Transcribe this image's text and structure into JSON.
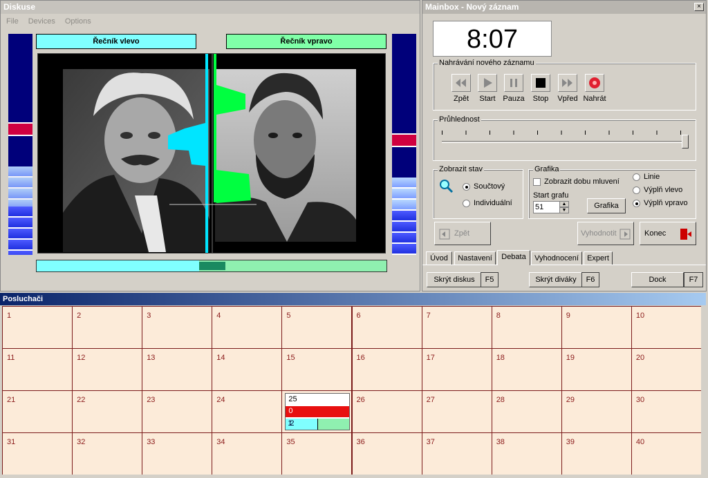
{
  "diskuse": {
    "title": "Diskuse",
    "menu": [
      "File",
      "Devices",
      "Options"
    ],
    "speaker_left": "Řečník vlevo",
    "speaker_right": "Řečník vpravo",
    "colors": {
      "left": "#80ffff",
      "right": "#80ffa8",
      "meter_bg": "#00007a",
      "meter_peak": "#d00040"
    }
  },
  "mainbox": {
    "title": "Mainbox - Nový záznam",
    "close": "×",
    "clock": "8:07",
    "recording": {
      "legend": "Nahrávání nového záznamu",
      "buttons": [
        {
          "label": "Zpět",
          "icon": "rewind-icon"
        },
        {
          "label": "Start",
          "icon": "play-icon"
        },
        {
          "label": "Pauza",
          "icon": "pause-icon"
        },
        {
          "label": "Stop",
          "icon": "stop-icon"
        },
        {
          "label": "Vpřed",
          "icon": "fast-forward-icon"
        },
        {
          "label": "Nahrát",
          "icon": "record-icon"
        }
      ]
    },
    "transparency": {
      "legend": "Průhlednost",
      "value": 1.0
    },
    "display": {
      "legend": "Zobrazit stav",
      "options": [
        "Součtový",
        "Individuální"
      ],
      "selected": "Součtový"
    },
    "graphics": {
      "legend": "Grafika",
      "show_time_label": "Zobrazit dobu mluvení",
      "start_label": "Start grafu",
      "start_value": "51",
      "button": "Grafika",
      "options": [
        "Linie",
        "Výplň vlevo",
        "Výplň vpravo"
      ],
      "selected": "Výplň vpravo"
    },
    "nav": {
      "back": "Zpět",
      "evaluate": "Vyhodnotit",
      "end": "Konec"
    },
    "tabs": [
      "Úvod",
      "Nastavení",
      "Debata",
      "Vyhodnocení",
      "Expert"
    ],
    "active_tab": "Debata",
    "bottom": {
      "hide_discussion": "Skrýt diskus",
      "f5": "F5",
      "hide_viewers": "Skrýt diváky",
      "f6": "F6",
      "dock": "Dock",
      "f7": "F7"
    }
  },
  "posluchaci": {
    "title": "Posluchači",
    "cells": [
      "1",
      "2",
      "3",
      "4",
      "5",
      "6",
      "7",
      "8",
      "9",
      "10",
      "11",
      "12",
      "13",
      "14",
      "15",
      "16",
      "17",
      "18",
      "19",
      "20",
      "21",
      "22",
      "23",
      "24",
      "25",
      "26",
      "27",
      "28",
      "29",
      "30",
      "31",
      "32",
      "33",
      "34",
      "35",
      "36",
      "37",
      "38",
      "39",
      "40"
    ],
    "special_cell": {
      "number": "25",
      "value": "0",
      "left": "1",
      "right": "2"
    }
  }
}
